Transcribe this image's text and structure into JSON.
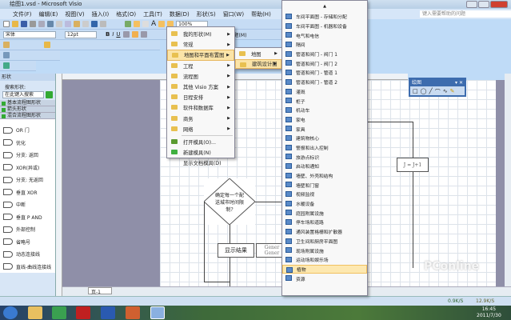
{
  "window": {
    "title": "绘图1.vsd - Microsoft Visio"
  },
  "menubar": [
    "文件(F)",
    "编辑(E)",
    "视图(V)",
    "插入(I)",
    "格式(O)",
    "工具(T)",
    "数据(D)",
    "形状(S)",
    "窗口(W)",
    "帮助(H)"
  ],
  "help": {
    "placeholder": "键入需要帮助的问题"
  },
  "toolbar": {
    "font": "宋体",
    "size": "12pt",
    "zoom": "100%",
    "theme": "主题(M)"
  },
  "shapes_panel": {
    "title": "形状",
    "search_label": "搜索形状:",
    "search_placeholder": "在此键入搜索",
    "stencils": [
      "基本流程图形状",
      "箭头形状",
      "混合流程图形状"
    ],
    "items": [
      "OR 门",
      "优化",
      "分支: 返回",
      "XOR(异或)",
      "分支: 无返回",
      "垂直 XOR",
      "中断",
      "垂直 P AND",
      "外部控制",
      "省略号",
      "动态连接线",
      "直线-曲线连接线"
    ]
  },
  "shapes_menu": {
    "items": [
      {
        "label": "我的形状(M)",
        "submenu": true
      },
      {
        "label": "常规",
        "submenu": true
      },
      {
        "label": "地图和平面布置图",
        "submenu": true,
        "highlighted": true
      },
      {
        "label": "工程",
        "submenu": true
      },
      {
        "label": "流程图",
        "submenu": true
      },
      {
        "label": "其他 Visio 方案",
        "submenu": true
      },
      {
        "label": "日程安排",
        "submenu": true
      },
      {
        "label": "软件和数据库",
        "submenu": true
      },
      {
        "label": "商务",
        "submenu": true
      },
      {
        "label": "网络",
        "submenu": true
      }
    ],
    "actions": [
      "打开模具(O)...",
      "新建模具(N)",
      "显示文档模具(D)"
    ]
  },
  "map_submenu": {
    "items": [
      "地图",
      "建筑设计图"
    ],
    "highlighted": "建筑设计图"
  },
  "architecture_submenu": {
    "items": [
      "车间平面图 - 存储和分配",
      "车间平面图 - 机器和设备",
      "电气和电信",
      "隔间",
      "管道和阀门 - 阀门 1",
      "管道和阀门 - 阀门 2",
      "管道和阀门 - 管道 1",
      "管道和阀门 - 管道 2",
      "灌溉",
      "柜子",
      "机动车",
      "家电",
      "家具",
      "建筑物核心",
      "警报和出入控制",
      "旅游点标识",
      "启动和通知",
      "墙壁、外壳和结构",
      "墙壁和门窗",
      "视频监视",
      "水暖设备",
      "庭园附属设施",
      "停车场和道路",
      "通风装置格栅和扩散器",
      "卫生间和厨房平面图",
      "现场附属设施",
      "运动场和娱乐场",
      "植物",
      "资源"
    ],
    "highlighted": "植物"
  },
  "canvas": {
    "decision": "确定每一个配送城市时间限制?",
    "result": "显示结果",
    "generic": "Gener Gener",
    "increment": "J = J+1",
    "page_tab": "页-1"
  },
  "drawing_toolbar": {
    "title": "绘图"
  },
  "status": {
    "down": "0.9K/S",
    "up": "12.9K/S"
  },
  "taskbar": {
    "time": "16:45",
    "date": "2011/7/30"
  },
  "watermark": "PConline"
}
